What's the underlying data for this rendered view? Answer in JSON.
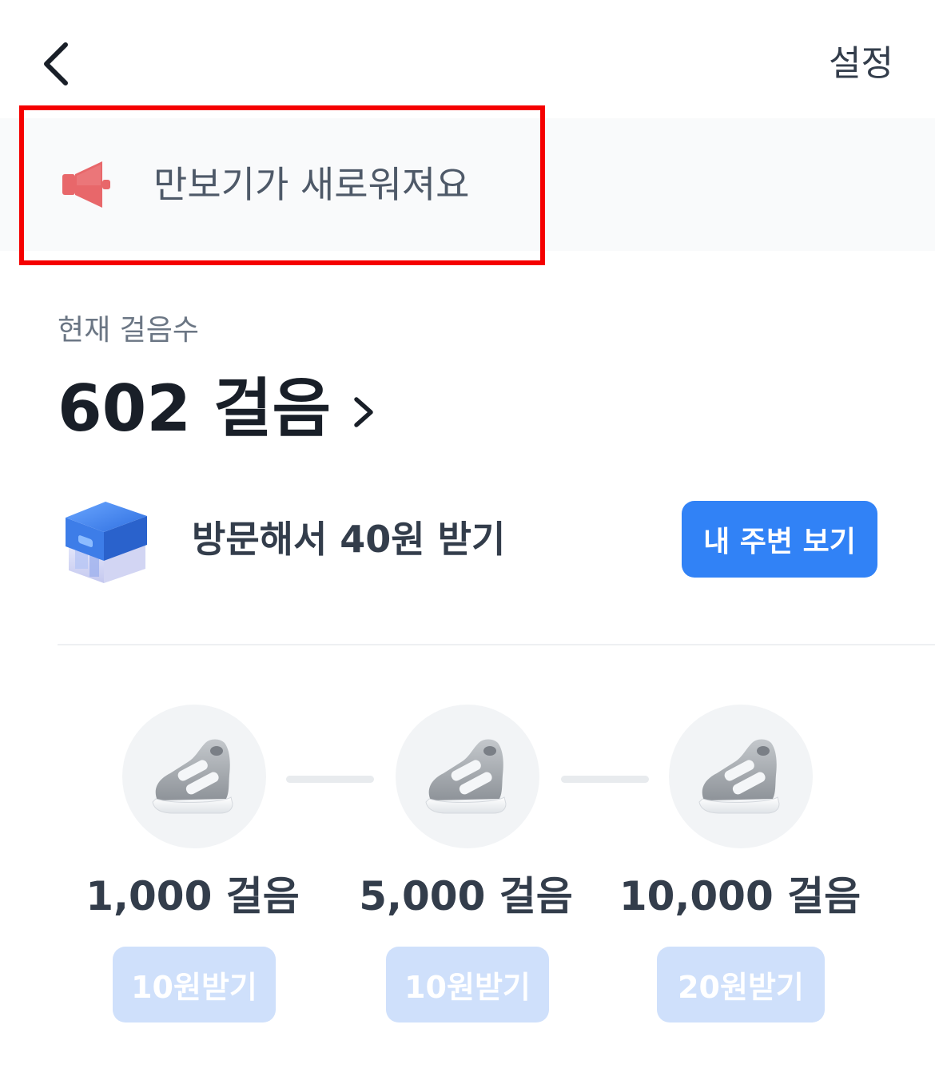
{
  "header": {
    "back_icon": "chevron-left-icon",
    "settings_label": "설정"
  },
  "notice": {
    "icon": "megaphone-icon",
    "text": "만보기가 새로워져요"
  },
  "steps": {
    "label": "현재 걸음수",
    "value": "602 걸음",
    "chevron_icon": "chevron-right-icon"
  },
  "visit": {
    "icon": "store-icon",
    "text": "방문해서 40원 받기",
    "button_label": "내 주변 보기"
  },
  "milestones": [
    {
      "icon": "shoe-icon",
      "label": "1,000 걸음",
      "reward": "10원받기"
    },
    {
      "icon": "shoe-icon",
      "label": "5,000 걸음",
      "reward": "10원받기"
    },
    {
      "icon": "shoe-icon",
      "label": "10,000 걸음",
      "reward": "20원받기"
    }
  ],
  "colors": {
    "accent": "#3182f6",
    "disabled_button": "#cfe0fb",
    "highlight_border": "#f50000",
    "megaphone": "#e8676a"
  }
}
